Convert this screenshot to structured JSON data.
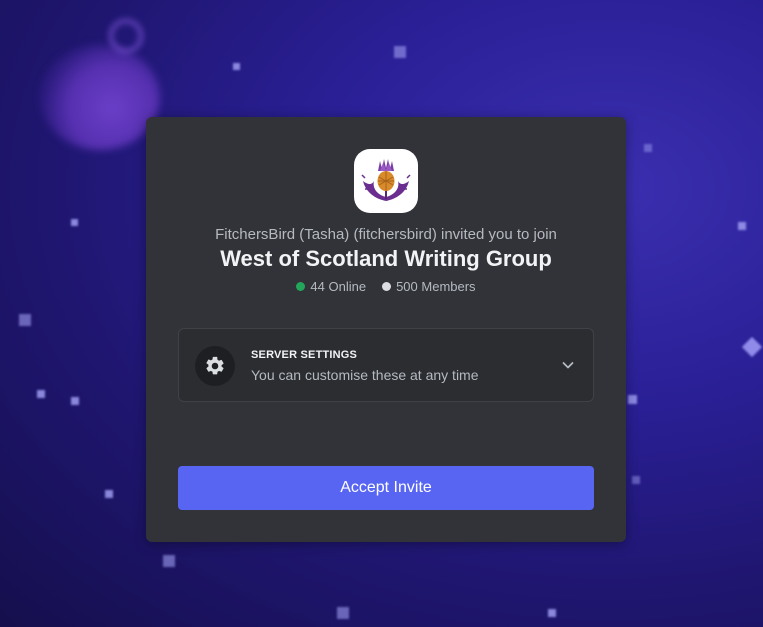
{
  "invite": {
    "inviter_text": "FitchersBird (Tasha) (fitchersbird) invited you to join",
    "server_name": "West of Scotland Writing Group",
    "online_count": "44 Online",
    "member_count": "500 Members",
    "online_color": "#23a55a",
    "members_color": "#dcdde2"
  },
  "settings": {
    "title": "SERVER SETTINGS",
    "subtitle": "You can customise these at any time",
    "icon": "gear-icon",
    "expand_icon": "chevron-down-icon"
  },
  "actions": {
    "accept_label": "Accept Invite",
    "accent_color": "#5865f2"
  }
}
